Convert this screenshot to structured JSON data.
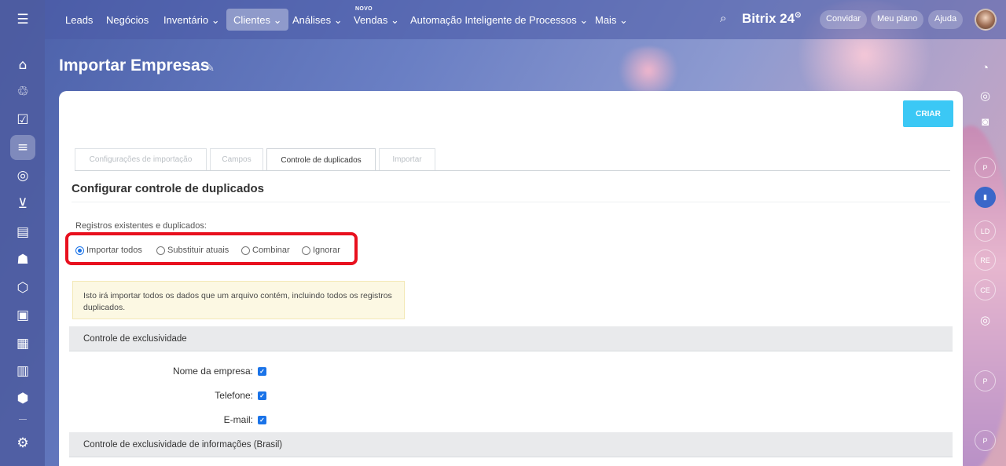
{
  "nav": {
    "items": [
      {
        "label": "Leads"
      },
      {
        "label": "Negócios"
      },
      {
        "label": "Inventário ⌄"
      },
      {
        "label": "Clientes ⌄"
      },
      {
        "label": "Análises ⌄"
      },
      {
        "label": "Vendas ⌄"
      },
      {
        "label": "Automação Inteligente de Processos ⌄"
      },
      {
        "label": "Mais ⌄"
      }
    ],
    "new_badge": "NOVO",
    "active_index": 3
  },
  "header": {
    "brand": "Bitrix 24",
    "brand_suffix": "⊙",
    "invite_label": "Convidar",
    "plan_label": "Meu plano",
    "help_label": "Ajuda"
  },
  "page": {
    "title": "Importar Empresas"
  },
  "toolbar": {
    "create_label": "CRIAR"
  },
  "tabs": [
    {
      "label": "Configurações de importação",
      "active": false
    },
    {
      "label": "Campos",
      "active": false
    },
    {
      "label": "Controle de duplicados",
      "active": true
    },
    {
      "label": "Importar",
      "active": false
    }
  ],
  "section": {
    "title": "Configurar controle de duplicados",
    "records_label": "Registros existentes e duplicados:",
    "radio_options": [
      {
        "label": "Importar todos",
        "checked": true
      },
      {
        "label": "Substituir atuais",
        "checked": false
      },
      {
        "label": "Combinar",
        "checked": false
      },
      {
        "label": "Ignorar",
        "checked": false
      }
    ],
    "note": "Isto irá importar todos os dados que um arquivo contém, incluindo todos os registros duplicados."
  },
  "uniqueness": {
    "header": "Controle de exclusividade",
    "fields": [
      {
        "label": "Nome da empresa:",
        "checked": true
      },
      {
        "label": "Telefone:",
        "checked": true
      },
      {
        "label": "E-mail:",
        "checked": true
      }
    ]
  },
  "uniqueness_brazil": {
    "header": "Controle de exclusividade de informações (Brasil)"
  },
  "right_rail": {
    "badges": [
      "P",
      "LD",
      "RE",
      "CE",
      "P",
      "P"
    ]
  },
  "colors": {
    "accent": "#3bc8f5",
    "highlight": "#e8101e",
    "check": "#1a73e8"
  }
}
